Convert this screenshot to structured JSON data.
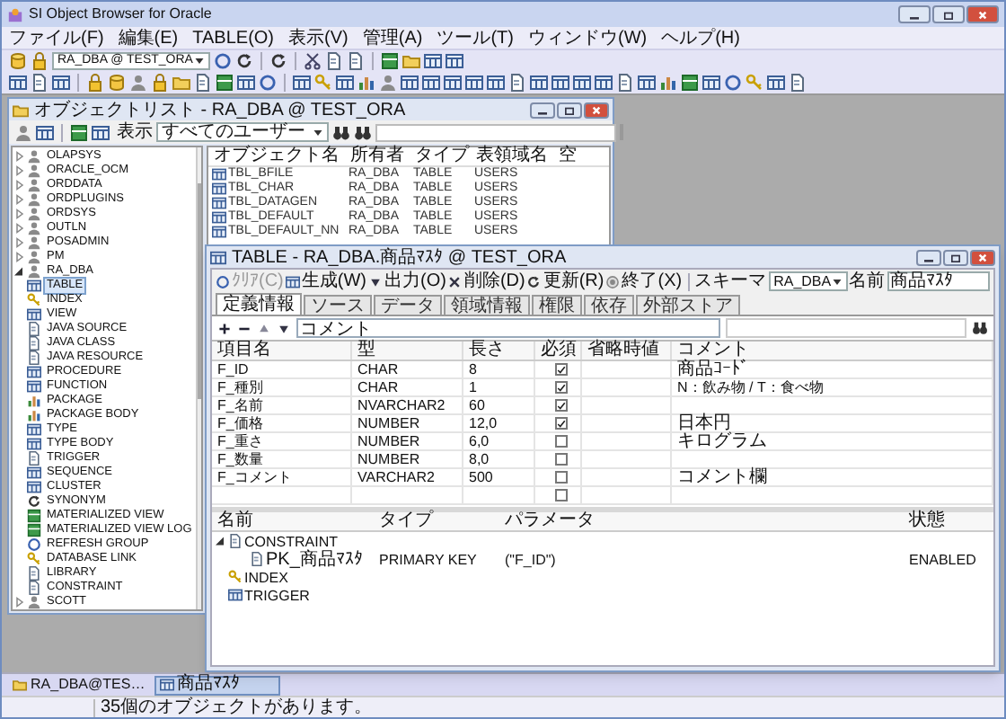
{
  "window": {
    "title": "SI Object Browser for Oracle"
  },
  "menu": [
    "ファイル(F)",
    "編集(E)",
    "TABLE(O)",
    "表示(V)",
    "管理(A)",
    "ツール(T)",
    "ウィンドウ(W)",
    "ヘルプ(H)"
  ],
  "toolbar": {
    "connection": "RA_DBA @ TEST_ORA"
  },
  "object_list": {
    "title": "オブジェクトリスト - RA_DBA @ TEST_ORA",
    "view_label": "表示",
    "user_filter": "すべてのユーザー",
    "tree": [
      {
        "label": "OLAPSYS",
        "expanded": false,
        "selected": false
      },
      {
        "label": "ORACLE_OCM",
        "expanded": false,
        "selected": false
      },
      {
        "label": "ORDDATA",
        "expanded": false,
        "selected": false
      },
      {
        "label": "ORDPLUGINS",
        "expanded": false,
        "selected": false
      },
      {
        "label": "ORDSYS",
        "expanded": false,
        "selected": false
      },
      {
        "label": "OUTLN",
        "expanded": false,
        "selected": false
      },
      {
        "label": "POSADMIN",
        "expanded": false,
        "selected": false
      },
      {
        "label": "PM",
        "expanded": false,
        "selected": false
      },
      {
        "label": "RA_DBA",
        "expanded": true,
        "selected": false,
        "children": [
          {
            "label": "TABLE",
            "selected": true
          },
          {
            "label": "INDEX",
            "selected": false
          },
          {
            "label": "VIEW",
            "selected": false
          },
          {
            "label": "JAVA SOURCE",
            "selected": false
          },
          {
            "label": "JAVA CLASS",
            "selected": false
          },
          {
            "label": "JAVA RESOURCE",
            "selected": false
          },
          {
            "label": "PROCEDURE",
            "selected": false
          },
          {
            "label": "FUNCTION",
            "selected": false
          },
          {
            "label": "PACKAGE",
            "selected": false
          },
          {
            "label": "PACKAGE BODY",
            "selected": false
          },
          {
            "label": "TYPE",
            "selected": false
          },
          {
            "label": "TYPE BODY",
            "selected": false
          },
          {
            "label": "TRIGGER",
            "selected": false
          },
          {
            "label": "SEQUENCE",
            "selected": false
          },
          {
            "label": "CLUSTER",
            "selected": false
          },
          {
            "label": "SYNONYM",
            "selected": false
          },
          {
            "label": "MATERIALIZED VIEW",
            "selected": false
          },
          {
            "label": "MATERIALIZED VIEW LOG",
            "selected": false
          },
          {
            "label": "REFRESH GROUP",
            "selected": false
          },
          {
            "label": "DATABASE LINK",
            "selected": false
          },
          {
            "label": "LIBRARY",
            "selected": false
          },
          {
            "label": "CONSTRAINT",
            "selected": false
          }
        ]
      },
      {
        "label": "SCOTT",
        "expanded": false,
        "selected": false
      }
    ],
    "columns": [
      "オブジェクト名",
      "所有者",
      "タイプ",
      "表領域名",
      "空"
    ],
    "rows": [
      [
        "TBL_BFILE",
        "RA_DBA",
        "TABLE",
        "USERS"
      ],
      [
        "TBL_CHAR",
        "RA_DBA",
        "TABLE",
        "USERS"
      ],
      [
        "TBL_DATAGEN",
        "RA_DBA",
        "TABLE",
        "USERS"
      ],
      [
        "TBL_DEFAULT",
        "RA_DBA",
        "TABLE",
        "USERS"
      ],
      [
        "TBL_DEFAULT_NN",
        "RA_DBA",
        "TABLE",
        "USERS"
      ]
    ]
  },
  "table_window": {
    "title": "TABLE - RA_DBA.商品ﾏｽﾀ @ TEST_ORA",
    "toolbar": [
      {
        "kind": "clear",
        "label": "ｸﾘｱ(C)",
        "disabled": true
      },
      {
        "kind": "generate",
        "label": "生成(W)",
        "disabled": false
      },
      {
        "kind": "output",
        "label": "出力(O)",
        "disabled": false
      },
      {
        "kind": "delete",
        "label": "削除(D)",
        "disabled": false
      },
      {
        "kind": "refresh",
        "label": "更新(R)",
        "disabled": false
      },
      {
        "kind": "close",
        "label": "終了(X)",
        "disabled": false
      }
    ],
    "schema_label": "スキーマ",
    "schema": "RA_DBA",
    "name_label": "名前",
    "name": "商品ﾏｽﾀ",
    "tabs": [
      {
        "label": "定義情報",
        "selected": true
      },
      {
        "label": "ソース",
        "selected": false
      },
      {
        "label": "データ",
        "selected": false
      },
      {
        "label": "領域情報",
        "selected": false
      },
      {
        "label": "権限",
        "selected": false
      },
      {
        "label": "依存",
        "selected": false
      },
      {
        "label": "外部ストア",
        "selected": false
      }
    ],
    "comment_field": "コメント",
    "columns": [
      "項目名",
      "型",
      "長さ",
      "必須",
      "省略時値",
      "コメント"
    ],
    "rows": [
      {
        "name": "F_ID",
        "type": "CHAR",
        "length": "8",
        "required": true,
        "comment": "商品ｺｰﾄﾞ"
      },
      {
        "name": "F_種別",
        "type": "CHAR",
        "length": "1",
        "required": true,
        "comment": "N：飲み物 / T：食べ物"
      },
      {
        "name": "F_名前",
        "type": "NVARCHAR2",
        "length": "60",
        "required": true
      },
      {
        "name": "F_価格",
        "type": "NUMBER",
        "length": "12,0",
        "required": true,
        "comment": "日本円"
      },
      {
        "name": "F_重さ",
        "type": "NUMBER",
        "length": "6,0",
        "required": false,
        "comment": "キログラム"
      },
      {
        "name": "F_数量",
        "type": "NUMBER",
        "length": "8,0",
        "required": false
      },
      {
        "name": "F_コメント",
        "type": "VARCHAR2",
        "length": "500",
        "required": false,
        "comment": "コメント欄"
      },
      {
        "required": false
      }
    ],
    "objects": {
      "columns": [
        "名前",
        "タイプ",
        "パラメータ",
        "状態"
      ],
      "tree": [
        {
          "name": "CONSTRAINT",
          "expanded": true,
          "children": [
            {
              "name": "PK_商品ﾏｽﾀ",
              "type": "PRIMARY KEY",
              "parameter": "(\"F_ID\")",
              "state": "ENABLED"
            }
          ]
        },
        {
          "name": "INDEX"
        },
        {
          "name": "TRIGGER"
        }
      ]
    }
  },
  "taskbar": [
    {
      "label": "RA_DBA@TES…",
      "selected": false
    },
    {
      "label": "商品ﾏｽﾀ",
      "selected": true
    }
  ],
  "status_bar": "35個のオブジェクトがあります。"
}
